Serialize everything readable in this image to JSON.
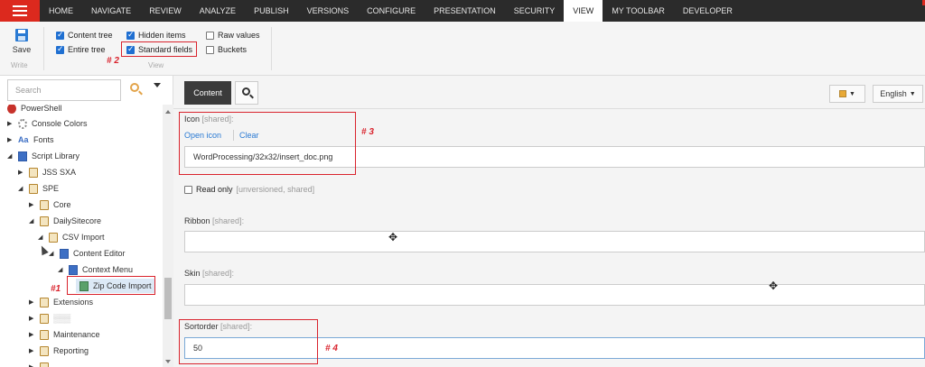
{
  "nav": {
    "tabs": [
      "HOME",
      "NAVIGATE",
      "REVIEW",
      "ANALYZE",
      "PUBLISH",
      "VERSIONS",
      "CONFIGURE",
      "PRESENTATION",
      "SECURITY",
      "VIEW",
      "MY TOOLBAR",
      "DEVELOPER"
    ],
    "active_tab": "VIEW"
  },
  "ribbon": {
    "save_label": "Save",
    "write_group": "Write",
    "view_group": "View",
    "checkboxes": {
      "content_tree": {
        "label": "Content tree",
        "checked": true
      },
      "entire_tree": {
        "label": "Entire tree",
        "checked": true
      },
      "hidden_items": {
        "label": "Hidden items",
        "checked": true
      },
      "standard_fields": {
        "label": "Standard fields",
        "checked": true
      },
      "raw_values": {
        "label": "Raw values",
        "checked": false
      },
      "buckets": {
        "label": "Buckets",
        "checked": false
      }
    }
  },
  "annotations": {
    "a1": "#1",
    "a2": "# 2",
    "a3": "# 3",
    "a4": "# 4"
  },
  "search": {
    "placeholder": "Search"
  },
  "tree": {
    "powershell": "PowerShell",
    "console_colors": "Console Colors",
    "fonts": "Fonts",
    "script_library": "Script Library",
    "jss_sxa": "JSS SXA",
    "spe": "SPE",
    "core": "Core",
    "daily_sitecore": "DailySitecore",
    "csv_import": "CSV Import",
    "content_editor": "Content Editor",
    "context_menu": "Context Menu",
    "zip_code_import": "Zip Code Import",
    "extensions": "Extensions",
    "blurred": "▒▒▒",
    "maintenance": "Maintenance",
    "reporting": "Reporting"
  },
  "editor": {
    "content_tab": "Content",
    "language": "English",
    "icon_label": "Icon",
    "icon_meta": "[shared]:",
    "open_icon": "Open icon",
    "clear": "Clear",
    "icon_value": "WordProcessing/32x32/insert_doc.png",
    "readonly_label": "Read only",
    "readonly_meta": "[unversioned, shared]",
    "ribbon_label": "Ribbon",
    "ribbon_meta": "[shared]:",
    "skin_label": "Skin",
    "skin_meta": "[shared]:",
    "sortorder_label": "Sortorder",
    "sortorder_meta": "[shared]:",
    "sortorder_value": "50"
  }
}
